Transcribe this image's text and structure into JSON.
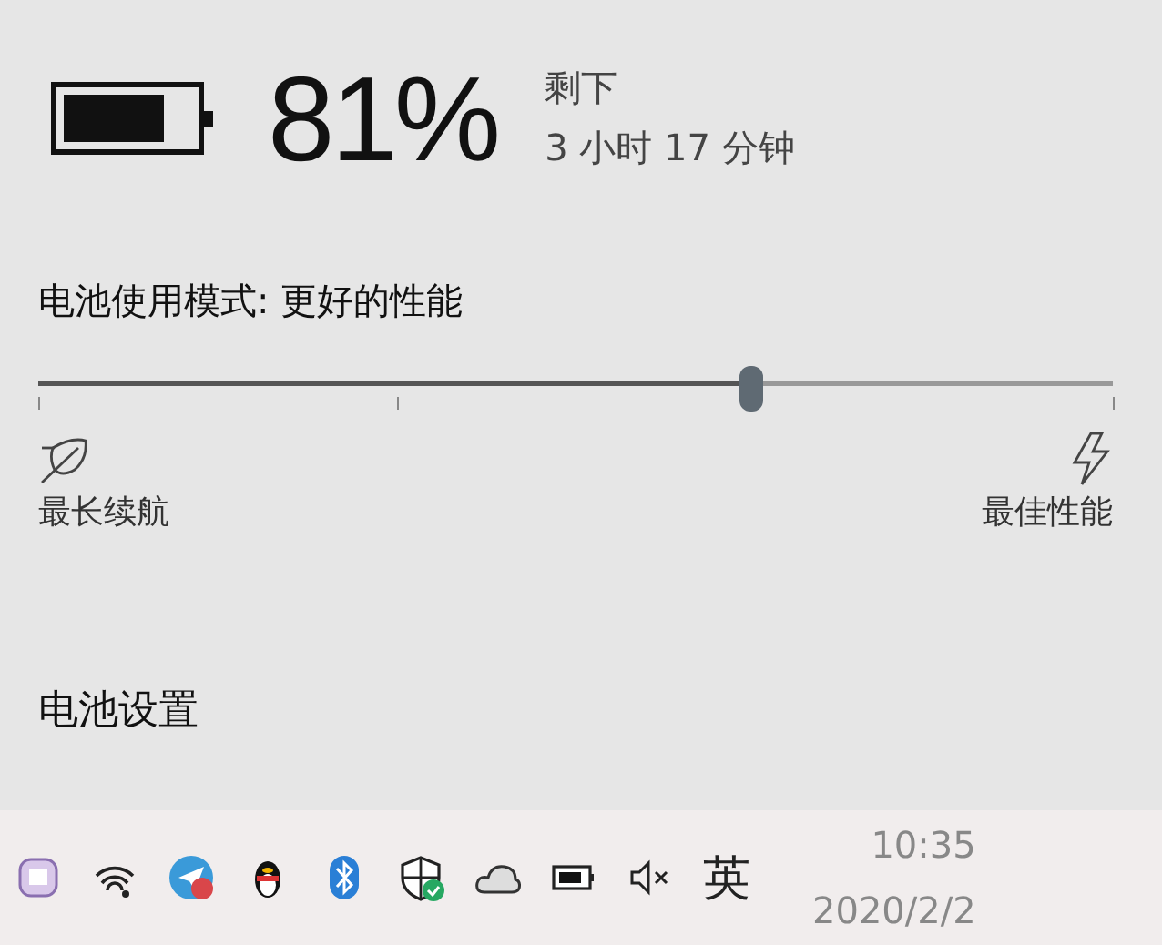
{
  "battery": {
    "percent": "81%",
    "remaining_label": "剩下",
    "remaining_time": "3 小时 17 分钟"
  },
  "power_mode": {
    "title": "电池使用模式: 更好的性能",
    "level": 0.663,
    "min_label": "最长续航",
    "max_label": "最佳性能"
  },
  "settings_link": "电池设置",
  "taskbar": {
    "tray_icons": [
      {
        "kind": "app"
      },
      {
        "kind": "wifi"
      },
      {
        "kind": "plane"
      },
      {
        "kind": "penguin"
      },
      {
        "kind": "bluetooth"
      },
      {
        "kind": "shield"
      },
      {
        "kind": "cloud"
      },
      {
        "kind": "battery"
      },
      {
        "kind": "mute"
      }
    ],
    "ime": "英",
    "time": "10:35",
    "date": "2020/2/2"
  }
}
